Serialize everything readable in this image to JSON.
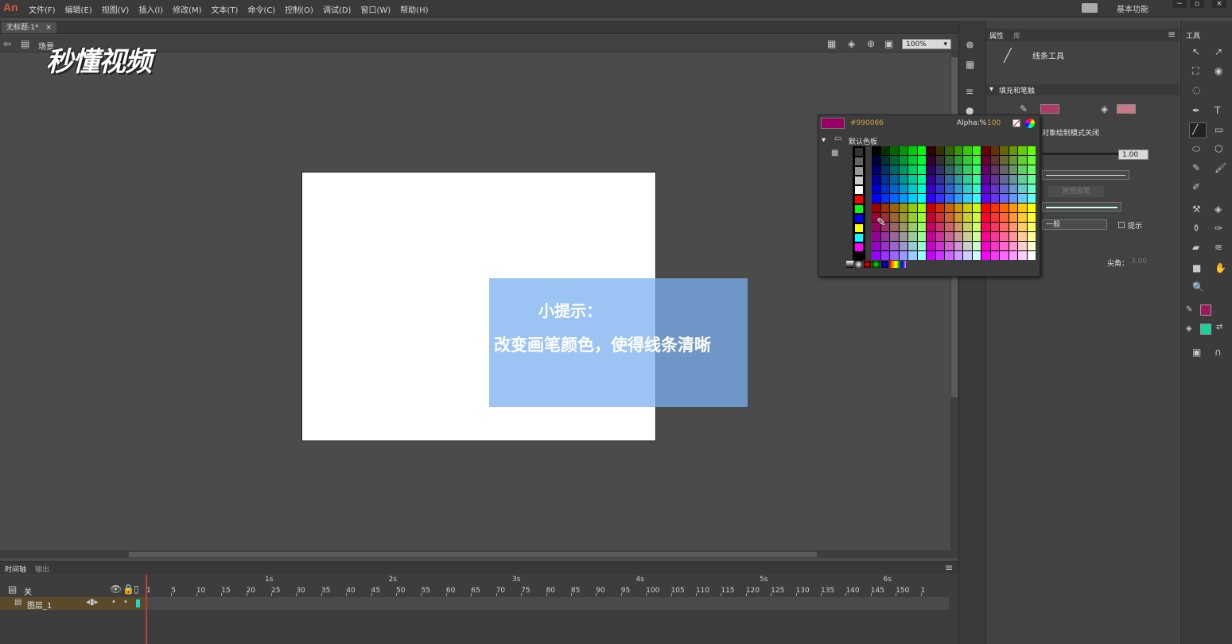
{
  "app": {
    "logo": "An",
    "workspace_label": "基本功能"
  },
  "menu": [
    "文件(F)",
    "编辑(E)",
    "视图(V)",
    "插入(I)",
    "修改(M)",
    "文本(T)",
    "命令(C)",
    "控制(O)",
    "调试(D)",
    "窗口(W)",
    "帮助(H)"
  ],
  "document": {
    "tab_title": "无标题-1*",
    "scene_label": "场景",
    "zoom": "100%"
  },
  "watermark": "秒懂视频",
  "tip": {
    "title": "小提示：",
    "body": "改变画笔颜色，使得线条清晰"
  },
  "timeline": {
    "tabs": [
      "时间轴",
      "输出"
    ],
    "second_labels": [
      "1s",
      "2s",
      "3s",
      "4s",
      "5s",
      "6s"
    ],
    "frame_labels": [
      "1",
      "5",
      "10",
      "15",
      "20",
      "25",
      "30",
      "35",
      "40",
      "45",
      "50",
      "55",
      "60",
      "65",
      "70",
      "75",
      "80",
      "85",
      "90",
      "95",
      "100",
      "105",
      "110",
      "115",
      "120",
      "125",
      "130",
      "135",
      "140",
      "145",
      "150",
      "1"
    ],
    "header_label": "关",
    "layer_name": "图层_1"
  },
  "properties": {
    "tabs": [
      "属性",
      "库"
    ],
    "tool_name": "线条工具",
    "section_fill_stroke": "填充和笔触",
    "object_draw_mode": "对象绘制模式关闭",
    "stroke_value": "1.00",
    "style_option": "一般",
    "hint_label": "提示",
    "miter_label": "尖角：",
    "miter_value": "3.00",
    "manage_button": "管理画笔",
    "stroke_color": "#b03a68",
    "fill_color": "#c77a86"
  },
  "swatches": {
    "hex_value": "#990066",
    "alpha_label": "Alpha:%",
    "alpha_value": "100",
    "palette_name": "默认色板",
    "current_color": "#990066"
  },
  "tools_panel": {
    "title": "工具",
    "stroke_color": "#a0165c",
    "fill_color": "#14d499"
  }
}
